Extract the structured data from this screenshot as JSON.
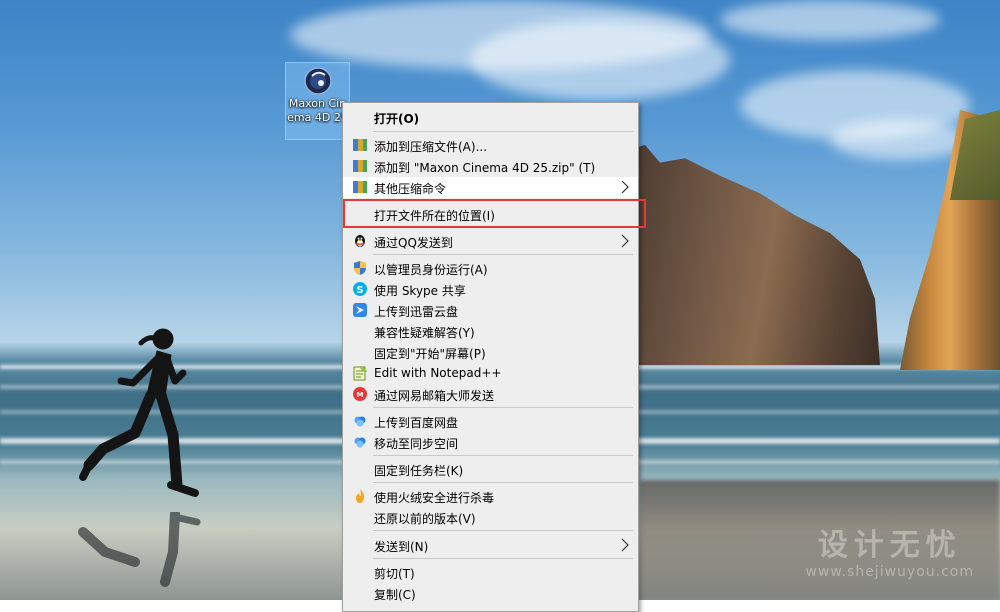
{
  "desktop": {
    "icon": {
      "name": "Maxon Cinema 4D 25",
      "icon": "cinema4d-icon"
    },
    "watermark": {
      "title": "设计无忧",
      "url": "www.shejiwuyou.com"
    }
  },
  "menu": {
    "open": "打开(O)",
    "add_archive": "添加到压缩文件(A)...",
    "add_zip": "添加到 \"Maxon Cinema 4D 25.zip\" (T)",
    "other_compress": "其他压缩命令",
    "open_location": "打开文件所在的位置(I)",
    "send_qq": "通过QQ发送到",
    "run_admin": "以管理员身份运行(A)",
    "skype_share": "使用 Skype 共享",
    "xunlei": "上传到迅雷云盘",
    "compat": "兼容性疑难解答(Y)",
    "pin_start": "固定到\"开始\"屏幕(P)",
    "notepad": "Edit with Notepad++",
    "netease_mail": "通过网易邮箱大师发送",
    "baidu": "上传到百度网盘",
    "sync_space": "移动至同步空间",
    "pin_taskbar": "固定到任务栏(K)",
    "huorong": "使用火绒安全进行杀毒",
    "restore": "还原以前的版本(V)",
    "send_to": "发送到(N)",
    "cut": "剪切(T)",
    "copy": "复制(C)"
  },
  "colors": {
    "highlight_border": "#e53935",
    "menu_bg": "#eeeeee",
    "hover_bg": "#ffffff"
  }
}
